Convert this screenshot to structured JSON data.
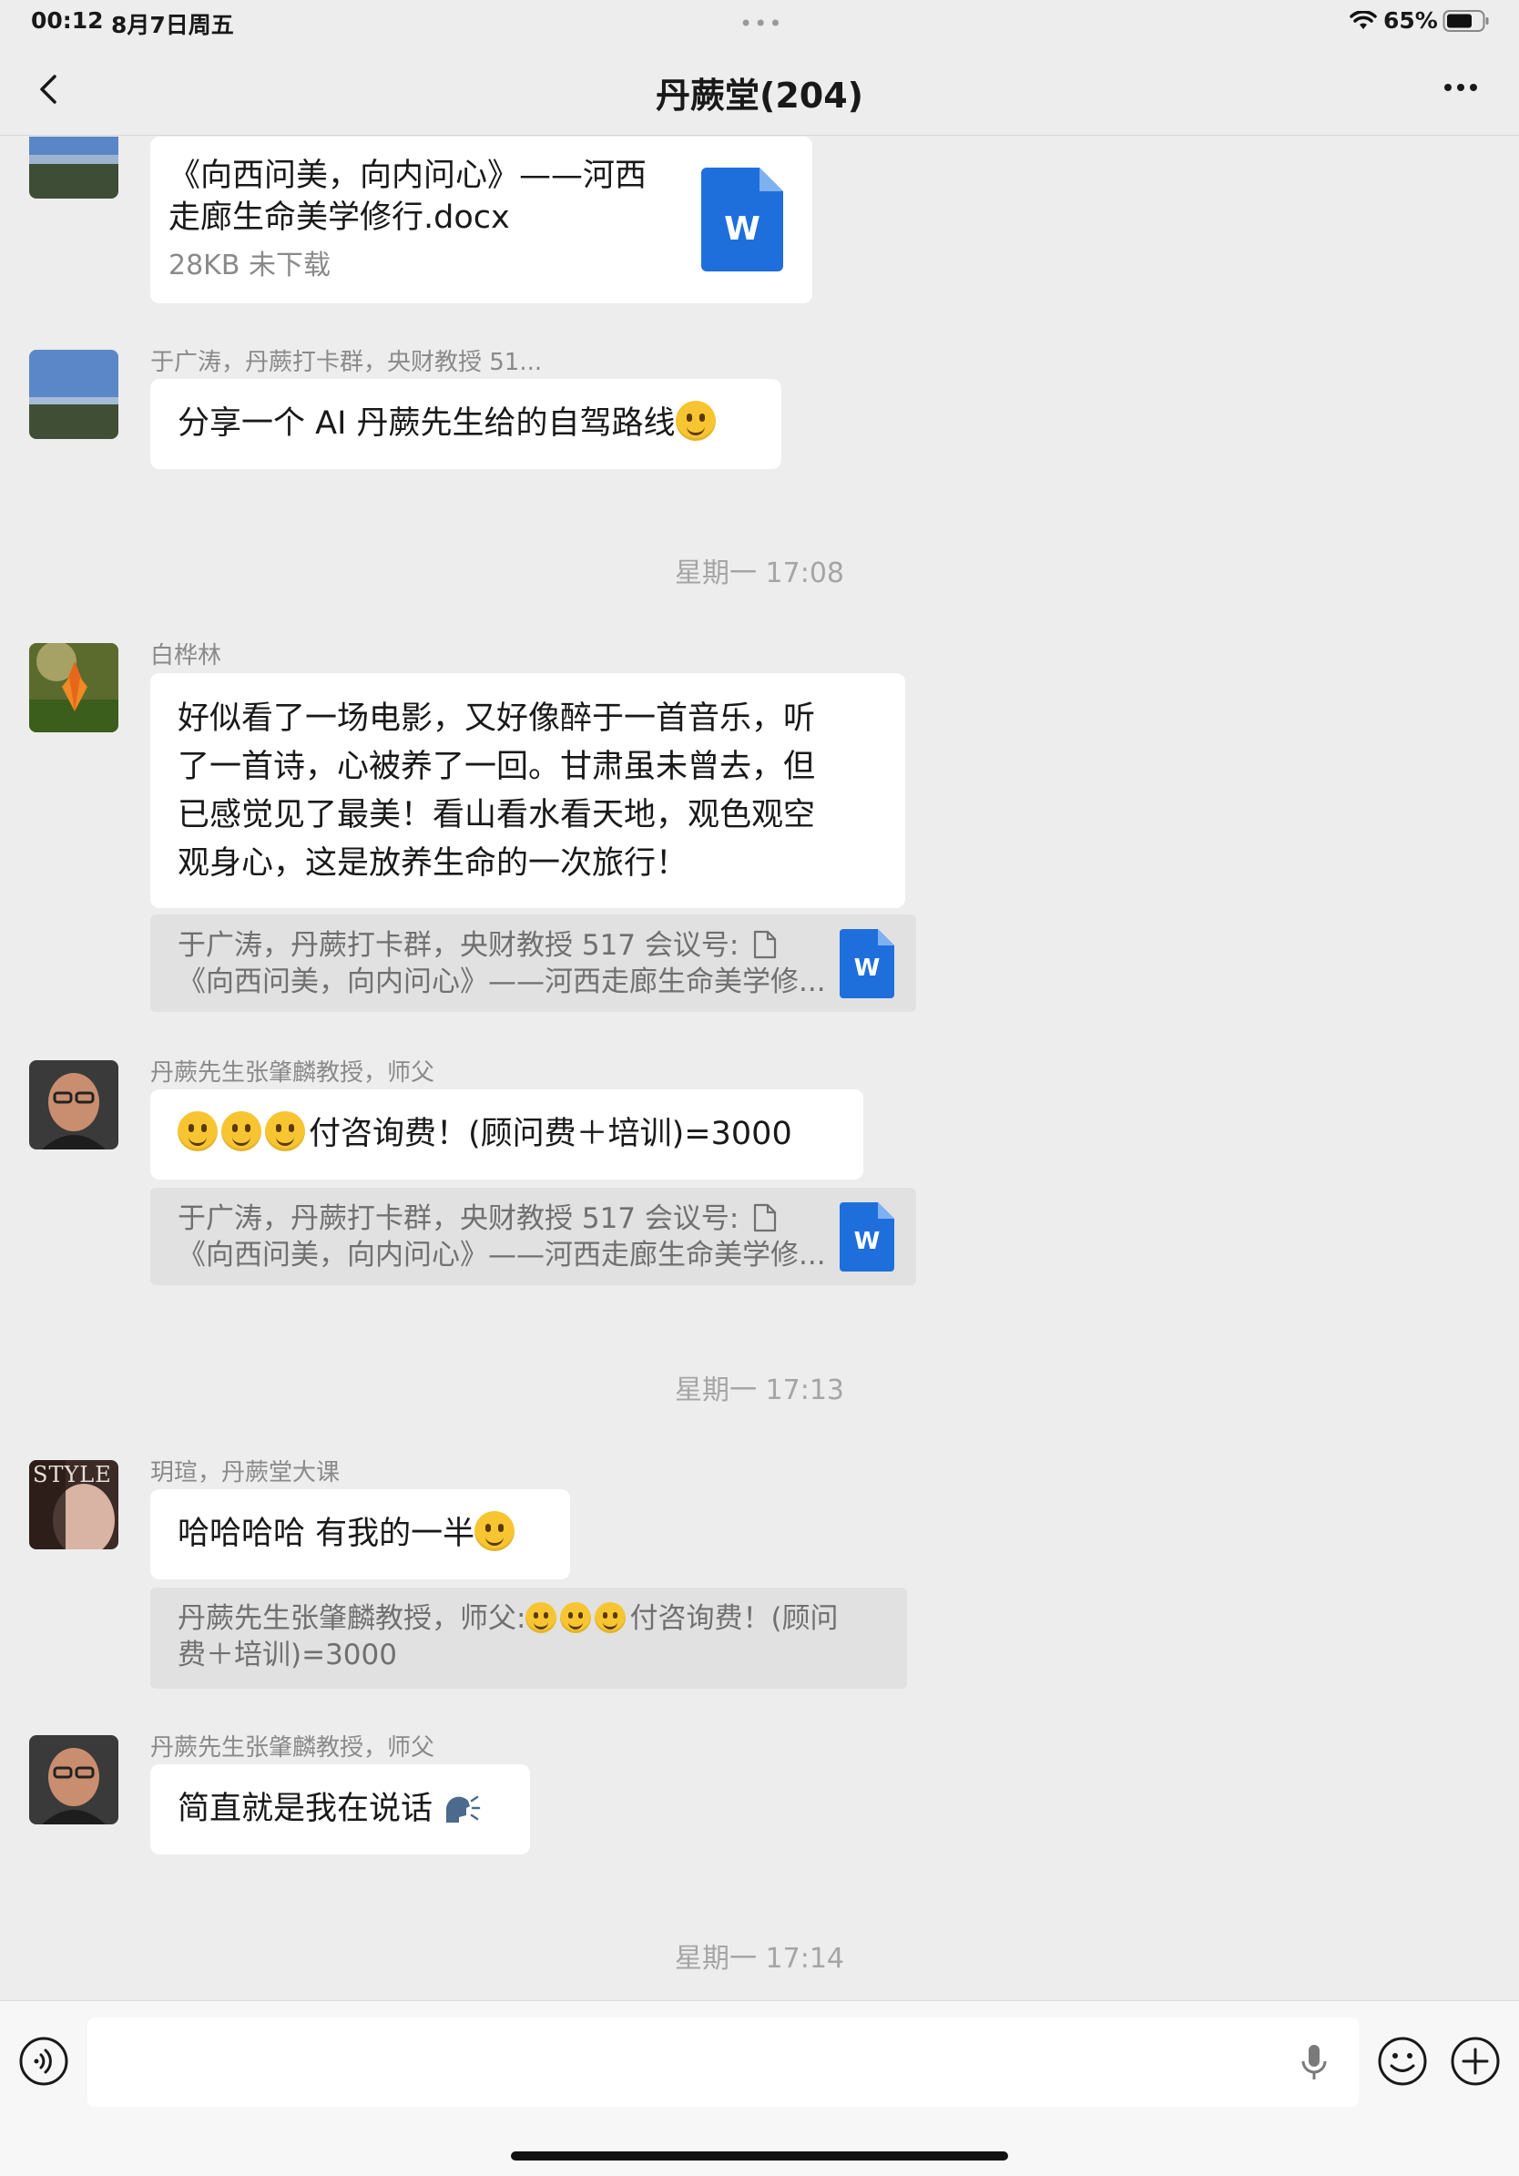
{
  "status_bar": {
    "time": "00:12",
    "date": "8月7日周五",
    "battery": "65%"
  },
  "nav": {
    "title": "丹蕨堂(204)"
  },
  "messages": {
    "file1": {
      "name_line1": "《向西问美，向内问心》——河西",
      "name_line2": "走廊生命美学修行.docx",
      "meta": "28KB  未下载",
      "icon_letter": "W"
    },
    "m2": {
      "sender": "于广涛，丹蕨打卡群，央财教授 51...",
      "text": "分享一个 AI 丹蕨先生给的自驾路线"
    },
    "ts1": "星期一 17:08",
    "m3": {
      "sender": "白桦林",
      "lines": [
        "好似看了一场电影，又好像醉于一首音乐，听",
        "了一首诗，心被养了一回。甘肃虽未曾去，但",
        "已感觉见了最美！看山看水看天地，观色观空",
        "观身心，这是放养生命的一次旅行！"
      ],
      "quote_line1": "于广涛，丹蕨打卡群，央财教授 517 会议号:",
      "quote_line2": "《向西问美，向内问心》——河西走廊生命美学修...",
      "icon_letter": "W"
    },
    "m4": {
      "sender": "丹蕨先生张肇麟教授，师父",
      "text": "付咨询费！(顾问费＋培训)=3000",
      "quote_line1": "于广涛，丹蕨打卡群，央财教授 517 会议号:",
      "quote_line2": "《向西问美，向内问心》——河西走廊生命美学修...",
      "icon_letter": "W"
    },
    "ts2": "星期一 17:13",
    "m5": {
      "sender": "玥瑄，丹蕨堂大课",
      "text": "哈哈哈哈 有我的一半",
      "avatar_text": "STYLE",
      "quote_prefix": "丹蕨先生张肇麟教授，师父:",
      "quote_text1": "付咨询费！(顾问",
      "quote_line2": "费＋培训)=3000"
    },
    "m6": {
      "sender": "丹蕨先生张肇麟教授，师父",
      "text": "简直就是我在说话"
    },
    "ts3": "星期一 17:14"
  },
  "colors": {
    "word_blue": "#1e6fdc",
    "background": "#ededed",
    "bubble": "#ffffff"
  },
  "icons": [
    "back-icon",
    "more-icon",
    "wifi-icon",
    "battery-icon",
    "voice-icon",
    "mic-icon",
    "emoji-icon",
    "plus-icon",
    "word-file-icon",
    "doc-icon"
  ]
}
